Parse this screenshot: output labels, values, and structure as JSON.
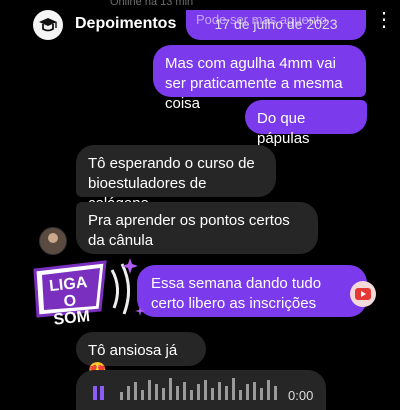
{
  "header": {
    "status_text": "Online há 13 min",
    "story_title": "Depoimentos",
    "menu_glyph": "⋮"
  },
  "date_banner": {
    "text": "17 de julho de 2023",
    "overlay_text": "Pode ser mas aguento"
  },
  "messages": [
    {
      "id": "b1",
      "from": "me",
      "text": "Mas com agulha 4mm vai ser praticamente a mesma coisa"
    },
    {
      "id": "b2",
      "from": "me",
      "text": "Do que pápulas"
    },
    {
      "id": "b3",
      "from": "them",
      "text": "Tô esperando o curso de bioestuladores de colágeno"
    },
    {
      "id": "b4",
      "from": "them",
      "text": "Pra aprender os pontos certos da cânula"
    },
    {
      "id": "b5",
      "from": "me",
      "text": "Essa semana dando tudo certo libero as inscrições"
    },
    {
      "id": "b6",
      "from": "them",
      "text": "Tô ansiosa já 😍"
    }
  ],
  "sticker": {
    "text": "LIGA O SOM"
  },
  "audio": {
    "duration": "0:00"
  },
  "colors": {
    "outgoing": "#7c3aed",
    "incoming": "#262626",
    "background": "#000000",
    "sticker_purple": "#7b2fbe"
  },
  "icons": [
    "story-logo-icon",
    "more-options-icon",
    "play-icon",
    "youtube-icon",
    "sparkle-icon",
    "sound-waves-icon"
  ]
}
